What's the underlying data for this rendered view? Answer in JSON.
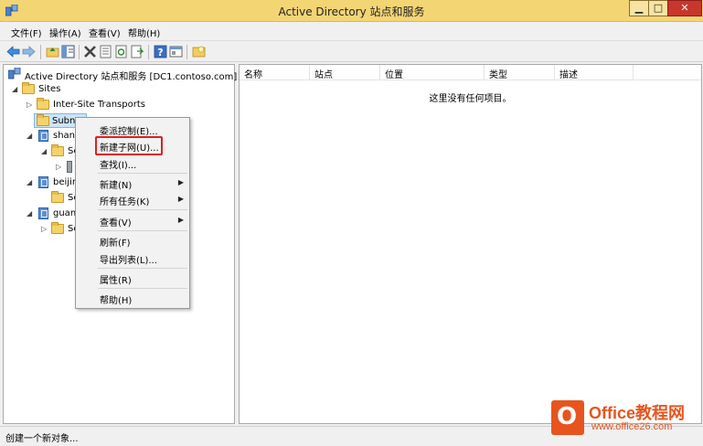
{
  "window": {
    "title": "Active Directory 站点和服务",
    "min_glyph": "▁",
    "max_glyph": "□",
    "close_glyph": "✕"
  },
  "menu": [
    "文件(F)",
    "操作(A)",
    "查看(V)",
    "帮助(H)"
  ],
  "toolbar_icons": [
    "back-arrow-icon",
    "forward-arrow-icon",
    "up-folder-icon",
    "show-hide-tree-icon",
    "delete-icon",
    "properties-icon",
    "refresh-icon",
    "export-list-icon",
    "help-icon",
    "show-console-icon",
    "new-object-icon"
  ],
  "tree": {
    "root": "Active Directory 站点和服务 [DC1.contoso.com]",
    "sites": "Sites",
    "inter_site": "Inter-Site Transports",
    "subnets": "Subne",
    "shanghai": "shang",
    "shanghai_servers": "Ser",
    "beijing": "beijing",
    "beijing_servers": "Ser",
    "guangzhou": "guang",
    "guangzhou_servers": "Ser",
    "expanded_glyph": "◢",
    "collapsed_glyph": "▷"
  },
  "list": {
    "columns": [
      "名称",
      "站点",
      "位置",
      "类型",
      "描述"
    ],
    "empty_message": "这里没有任何项目。"
  },
  "context_menu": {
    "items": [
      "委派控制(E)...",
      "新建子网(U)...",
      "查找(I)...",
      "新建(N)",
      "所有任务(K)",
      "查看(V)",
      "刷新(F)",
      "导出列表(L)...",
      "属性(R)",
      "帮助(H)"
    ],
    "submenu_glyph": "▶"
  },
  "status": "创建一个新对象...",
  "watermark": {
    "logo_letter": "O",
    "brand": "Office教程网",
    "url": "www.office26.com"
  },
  "colors": {
    "title_bar": "#f4d574",
    "selection": "#cce4f7",
    "highlight_box": "#e0201b",
    "watermark": "#e8541e"
  }
}
